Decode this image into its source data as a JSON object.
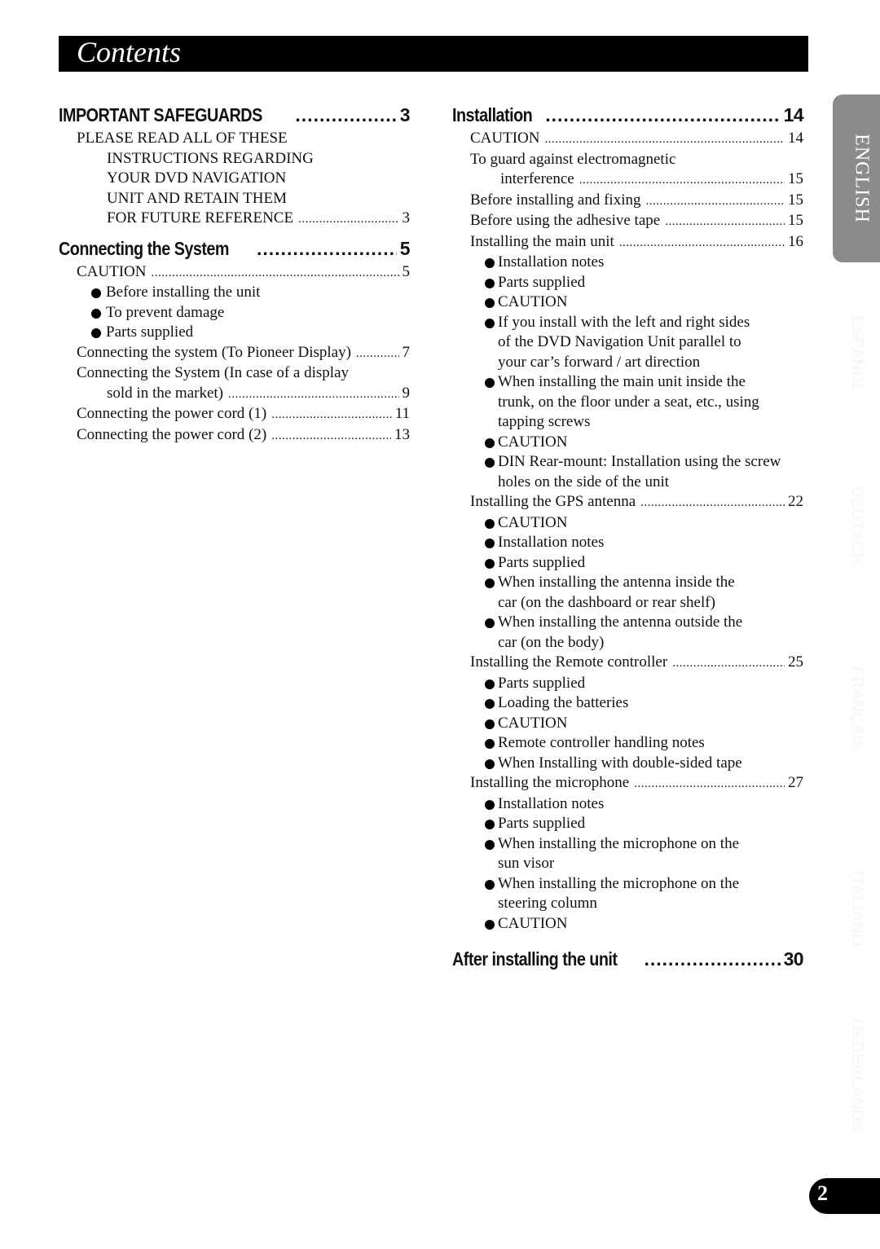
{
  "page_title": "Contents",
  "language_tab": "ENGLISH",
  "ghost_tabs": [
    "ESPAÑOL",
    "DEUTSCH",
    "FRANÇAIS",
    "ITALIANO",
    "NEDERLANDS"
  ],
  "page_number": "2",
  "left": {
    "safeguards": {
      "heading": "IMPORTANT SAFEGUARDS",
      "page": "3",
      "lines": [
        "PLEASE READ ALL OF THESE",
        "INSTRUCTIONS REGARDING",
        "YOUR DVD NAVIGATION",
        "UNIT AND RETAIN THEM"
      ],
      "last_line": "FOR FUTURE REFERENCE",
      "last_page": "3"
    },
    "connecting": {
      "heading": "Connecting the System",
      "page": "5",
      "caution": {
        "label": "CAUTION",
        "page": "5"
      },
      "bullets": [
        "Before installing the unit",
        "To prevent damage",
        "Parts supplied"
      ],
      "entry1": {
        "label": "Connecting the system (To Pioneer Display)",
        "page": "7"
      },
      "entry2_line1": "Connecting the System (In case of a display",
      "entry2": {
        "label": "sold in the market)",
        "page": "9"
      },
      "entry3": {
        "label": "Connecting the power cord (1)",
        "page": "11"
      },
      "entry4": {
        "label": "Connecting the power cord (2)",
        "page": "13"
      }
    }
  },
  "right": {
    "installation": {
      "heading": "Installation",
      "page": "14",
      "caution": {
        "label": "CAUTION",
        "page": "14"
      },
      "guard_line1": "To guard against electromagnetic",
      "guard": {
        "label": "interference",
        "page": "15"
      },
      "before_fixing": {
        "label": "Before installing and fixing",
        "page": "15"
      },
      "adhesive": {
        "label": "Before using the adhesive tape",
        "page": "15"
      },
      "main_unit": {
        "label": "Installing the main unit",
        "page": "16",
        "bullets": [
          {
            "lines": [
              "Installation notes"
            ]
          },
          {
            "lines": [
              "Parts supplied"
            ]
          },
          {
            "lines": [
              "CAUTION"
            ]
          },
          {
            "lines": [
              "If you install with the left and right sides",
              "of the DVD Navigation Unit parallel to",
              "your car’s forward / art direction"
            ]
          },
          {
            "lines": [
              "When installing the main unit inside the",
              "trunk, on the floor under a seat, etc., using",
              "tapping screws"
            ]
          },
          {
            "lines": [
              "CAUTION"
            ]
          },
          {
            "lines": [
              "DIN Rear-mount: Installation using the screw",
              "holes on the side of the unit"
            ]
          }
        ]
      },
      "gps": {
        "label": "Installing the GPS antenna",
        "page": "22",
        "bullets": [
          {
            "lines": [
              "CAUTION"
            ]
          },
          {
            "lines": [
              "Installation notes"
            ]
          },
          {
            "lines": [
              "Parts supplied"
            ]
          },
          {
            "lines": [
              "When installing the antenna inside the",
              "car (on the dashboard or rear shelf)"
            ]
          },
          {
            "lines": [
              "When installing the antenna outside the",
              "car (on the body)"
            ]
          }
        ]
      },
      "remote": {
        "label": "Installing the Remote controller",
        "page": "25",
        "bullets": [
          {
            "lines": [
              "Parts supplied"
            ]
          },
          {
            "lines": [
              "Loading the batteries"
            ]
          },
          {
            "lines": [
              "CAUTION"
            ]
          },
          {
            "lines": [
              "Remote controller handling notes"
            ]
          },
          {
            "lines": [
              "When Installing with double-sided tape"
            ]
          }
        ]
      },
      "microphone": {
        "label": "Installing the microphone",
        "page": "27",
        "bullets": [
          {
            "lines": [
              "Installation notes"
            ]
          },
          {
            "lines": [
              "Parts supplied"
            ]
          },
          {
            "lines": [
              "When installing the microphone on the",
              "sun visor"
            ]
          },
          {
            "lines": [
              "When installing the microphone on the",
              "steering column"
            ]
          },
          {
            "lines": [
              "CAUTION"
            ]
          }
        ]
      }
    },
    "after": {
      "heading": "After installing the unit",
      "page": "30"
    }
  }
}
